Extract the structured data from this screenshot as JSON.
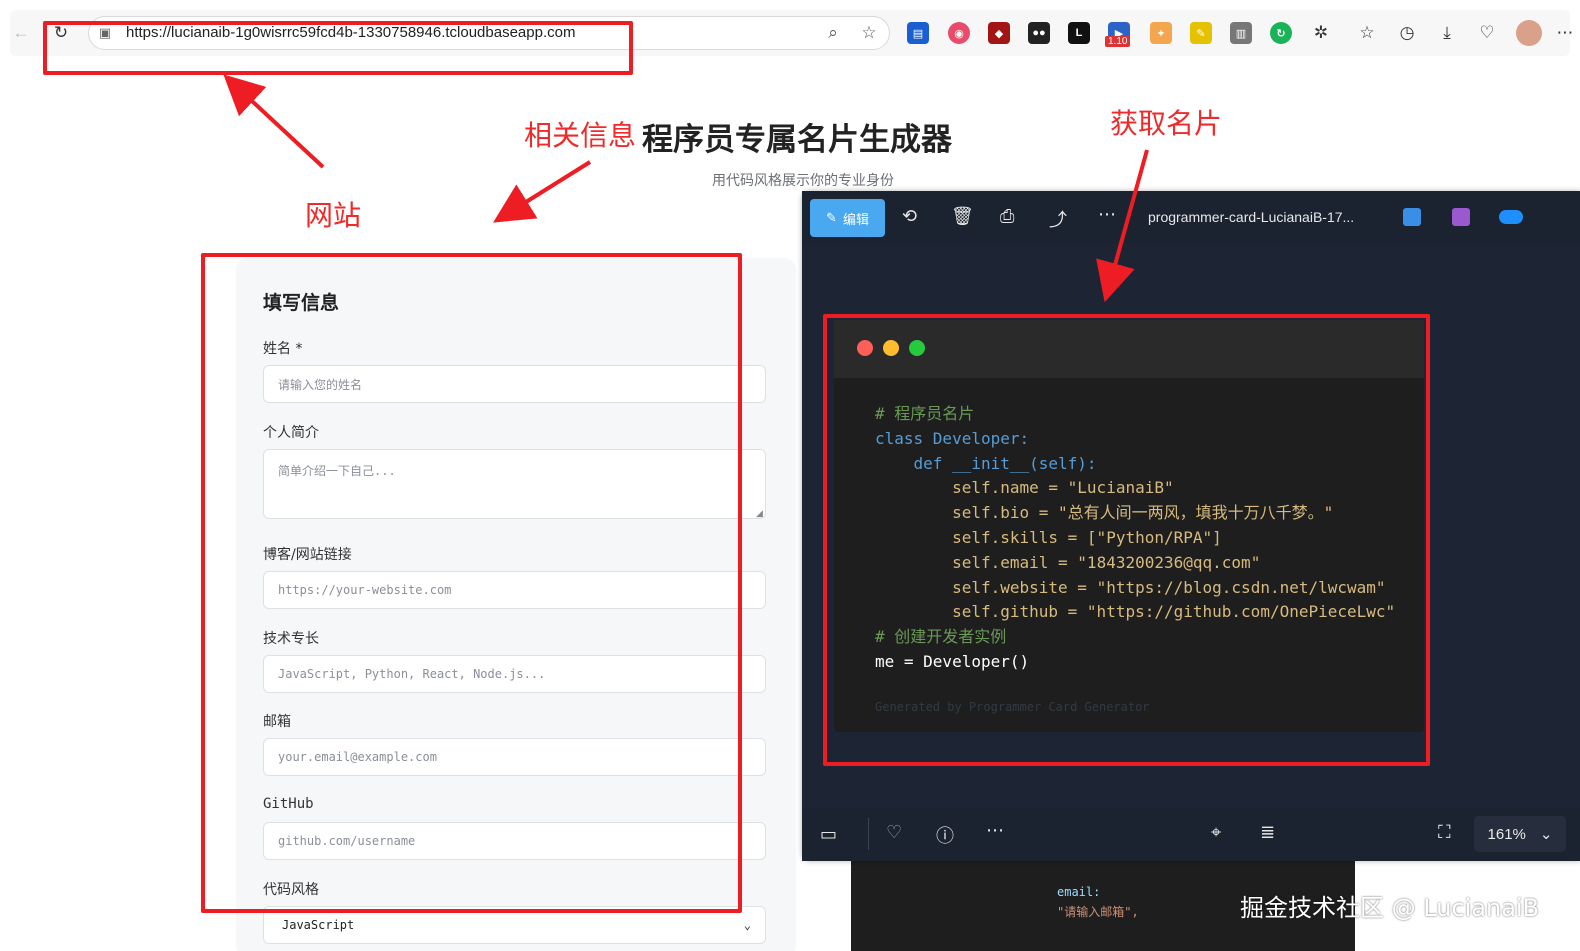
{
  "browser": {
    "url": "https://lucianaib-1g0wisrrc59fcd4b-1330758946.tcloudbaseapp.com",
    "ext_badge": "1.10"
  },
  "annotations": {
    "website": "网站",
    "related_info": "相关信息",
    "get_card": "获取名片"
  },
  "page": {
    "title": "程序员专属名片生成器",
    "subtitle": "用代码风格展示你的专业身份"
  },
  "form": {
    "title": "填写信息",
    "fields": [
      {
        "label": "姓名 *",
        "placeholder": "请输入您的姓名"
      },
      {
        "label": "个人简介",
        "placeholder": "简单介绍一下自己..."
      },
      {
        "label": "博客/网站链接",
        "placeholder": "https://your-website.com"
      },
      {
        "label": "技术专长",
        "placeholder": "JavaScript, Python, React, Node.js..."
      },
      {
        "label": "邮箱",
        "placeholder": "your.email@example.com"
      },
      {
        "label": "GitHub",
        "placeholder": "github.com/username"
      },
      {
        "label": "代码风格",
        "value": "JavaScript"
      }
    ]
  },
  "viewer": {
    "edit_label": "编辑",
    "file_title": "programmer-card-LucianaiB-17...",
    "zoom": "161%",
    "code": {
      "comment1": "# 程序员名片",
      "class_line": "class Developer:",
      "def_line": "    def __init__(self):",
      "name_attr": "        self.name = ",
      "name_val": "\"LucianaiB\"",
      "bio_attr": "        self.bio = ",
      "bio_val": "\"总有人间一两风，填我十万八千梦。\"",
      "skills_attr": "        self.skills = ",
      "skills_val": "[\"Python/RPA\"]",
      "email_attr": "        self.email = ",
      "email_val": "\"1843200236@qq.com\"",
      "website_attr": "        self.website = ",
      "website_val": "\"https://blog.csdn.net/lwcwam\"",
      "github_attr": "        self.github = ",
      "github_val": "\"https://github.com/OnePieceLwc\"",
      "comment2": "# 创建开发者实例",
      "me_line": "me = Developer()",
      "footer": "Generated by Programmer Card Generator"
    }
  },
  "background_code": {
    "line1": "email:",
    "line2": "\"请输入邮箱\","
  },
  "watermark": "掘金技术社区 @ LucianaiB"
}
